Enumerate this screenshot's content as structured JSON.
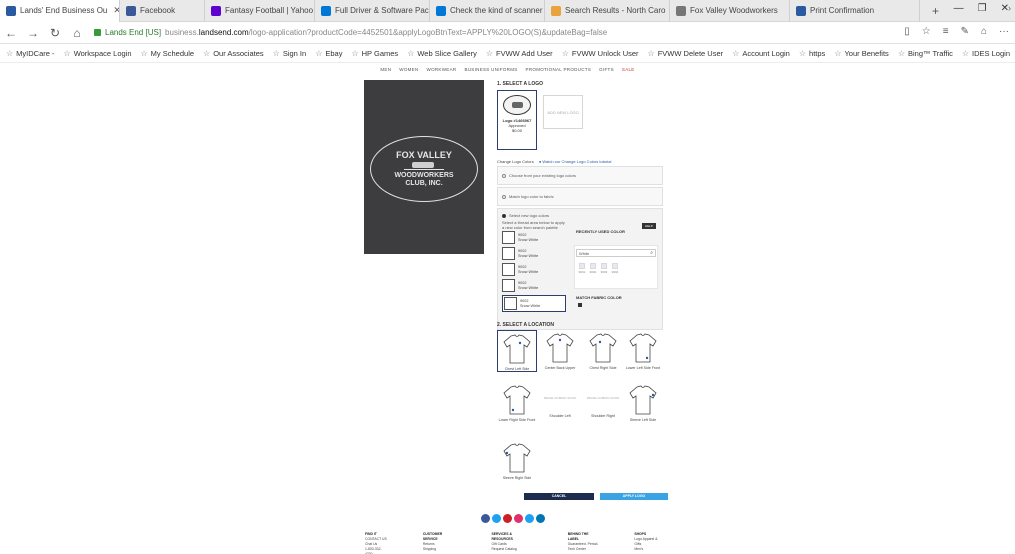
{
  "tabs": [
    {
      "label": "Lands' End Business Ou",
      "active": true,
      "color": "#2c5aa0"
    },
    {
      "label": "Facebook",
      "active": false,
      "color": "#3b5998"
    },
    {
      "label": "Fantasy Football | Yahoo Sp",
      "active": false,
      "color": "#5f01d1"
    },
    {
      "label": "Full Driver & Software Packa",
      "active": false,
      "color": "#0078d7"
    },
    {
      "label": "Check the kind of scanner c",
      "active": false,
      "color": "#0078d7"
    },
    {
      "label": "Search Results - North Caro",
      "active": false,
      "color": "#e8a33d"
    },
    {
      "label": "Fox Valley Woodworkers",
      "active": false,
      "color": "#777777"
    },
    {
      "label": "Print Confirmation",
      "active": false,
      "color": "#2c5aa0"
    }
  ],
  "address": {
    "site_label": "Lands End [US]",
    "url_prefix": "business.",
    "url_host": "landsend.com",
    "url_rest": "/logo-application?productCode=4452501&applyLogoBtnText=APPLY%20LOGO(S)&updateBag=false"
  },
  "favorites": [
    "MyIDCare -",
    "Workspace Login",
    "My Schedule",
    "Our Associates",
    "Sign In",
    "Ebay",
    "HP Games",
    "Web Slice Gallery",
    "FVWW Add User",
    "FVWW Unlock User",
    "FVWW Delete User",
    "Account Login",
    "https",
    "Your Benefits",
    "Bing™ Traffic",
    "IDES Login"
  ],
  "site_nav": [
    "MEN",
    "WOMEN",
    "WORKWEAR",
    "BUSINESS UNIFORMS",
    "PROMOTIONAL PRODUCTS",
    "GIFTS",
    "SALE"
  ],
  "product_logo": {
    "line1": "FOX VALLEY",
    "line2": "WOODWORKERS",
    "line3": "CLUB, INC."
  },
  "panel": {
    "select_logo_title": "1. SELECT A LOGO",
    "logo_tile": {
      "id": "Logo #1466967",
      "status": "Approved",
      "price": "$0.00"
    },
    "add_logo": "ADD NEW LOGO",
    "change_colors": "Change Logo Colors",
    "tutorial_link": "Watch our Change Logo Colors tutorial",
    "option1": "Choose from your existing logo colors",
    "option2": "Match logo color to fabric",
    "option3": "Select new logo colors",
    "select_hint": "Select a thread area below to apply a new color from search palette",
    "swatches": [
      {
        "code": "9002",
        "name": "Snow White"
      },
      {
        "code": "9002",
        "name": "Snow White"
      },
      {
        "code": "9002",
        "name": "Snow White"
      },
      {
        "code": "9002",
        "name": "Snow White"
      },
      {
        "code": "9002",
        "name": "Snow White"
      }
    ],
    "recent_title": "RECENTLY USED COLOR",
    "help_label": "HELP",
    "search_value": "White",
    "chips": [
      "9001",
      "9002",
      "9003",
      "9004"
    ],
    "match_fabric": "MATCH FABRIC COLOR"
  },
  "location": {
    "title": "2. SELECT A LOCATION",
    "items": [
      {
        "label": "Chest Left Side",
        "available": true,
        "selected": true
      },
      {
        "label": "Center Back Upper",
        "available": true,
        "selected": false
      },
      {
        "label": "Chest Right Side",
        "available": true,
        "selected": false
      },
      {
        "label": "Lower Left Side Front",
        "available": true,
        "selected": false
      },
      {
        "label": "Lower Right Side Front",
        "available": true,
        "selected": false
      },
      {
        "label": "Shoulder Left",
        "available": false,
        "selected": false
      },
      {
        "label": "Shoulder Right",
        "available": false,
        "selected": false
      },
      {
        "label": "Sleeve Left Side",
        "available": true,
        "selected": false
      },
      {
        "label": "Sleeve Right Side",
        "available": true,
        "selected": false
      }
    ],
    "na_text": "IMAGE COMING SOON"
  },
  "buttons": {
    "cancel": "CANCEL",
    "apply": "APPLY LOGO"
  },
  "social_colors": [
    "#3b5998",
    "#1da1f2",
    "#cb2027",
    "#e1306c",
    "#1da1f2",
    "#0077b5"
  ],
  "footer": [
    {
      "head": "FIND IT",
      "items": [
        "CONTACT US",
        "Chat Us",
        "1-800-332-4700"
      ]
    },
    {
      "head": "CUSTOMER SERVICE",
      "items": [
        "Returns",
        "Shipping"
      ]
    },
    {
      "head": "SERVICES & RESOURCES",
      "items": [
        "Gift Cards",
        "Request Catalog"
      ]
    },
    {
      "head": "BEHIND THE LABEL",
      "items": [
        "Guaranteed. Period.",
        "Tech Center"
      ]
    },
    {
      "head": "SHOPS",
      "items": [
        "Logo Apparel & Gifts",
        "Men's"
      ]
    }
  ]
}
